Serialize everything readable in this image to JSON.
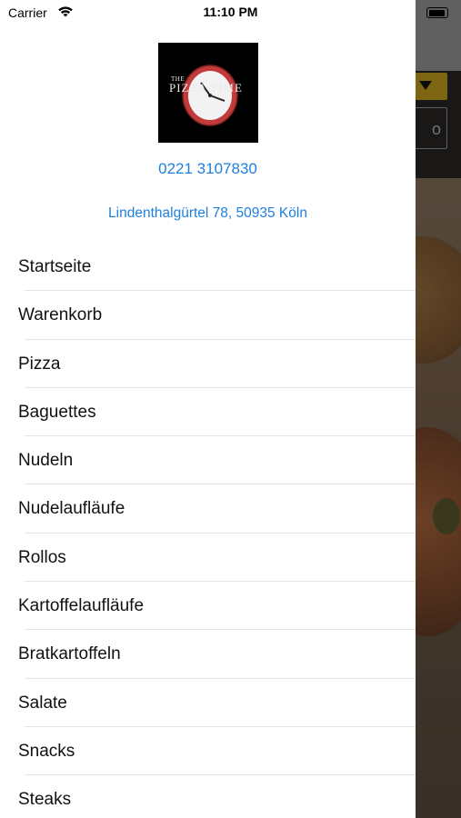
{
  "status_bar": {
    "carrier": "Carrier",
    "time": "11:10 PM"
  },
  "logo": {
    "the": "THE",
    "name": "PIZZA TIME"
  },
  "contact": {
    "phone": "0221 3107830",
    "address": "Lindenthalgürtel 78, 50935 Köln"
  },
  "menu": [
    {
      "label": "Startseite"
    },
    {
      "label": "Warenkorb"
    },
    {
      "label": "Pizza"
    },
    {
      "label": "Baguettes"
    },
    {
      "label": "Nudeln"
    },
    {
      "label": "Nudelaufläufe"
    },
    {
      "label": "Rollos"
    },
    {
      "label": "Kartoffelaufläufe"
    },
    {
      "label": "Bratkartoffeln"
    },
    {
      "label": "Salate"
    },
    {
      "label": "Snacks"
    },
    {
      "label": "Steaks"
    }
  ],
  "background": {
    "search_glyph": "o"
  },
  "colors": {
    "link": "#1e7fe0",
    "accent": "#c9a51c",
    "drawer": "#ffffff"
  },
  "icons": [
    "wifi-icon",
    "battery-icon",
    "dropdown-arrow-icon",
    "clock-icon"
  ]
}
